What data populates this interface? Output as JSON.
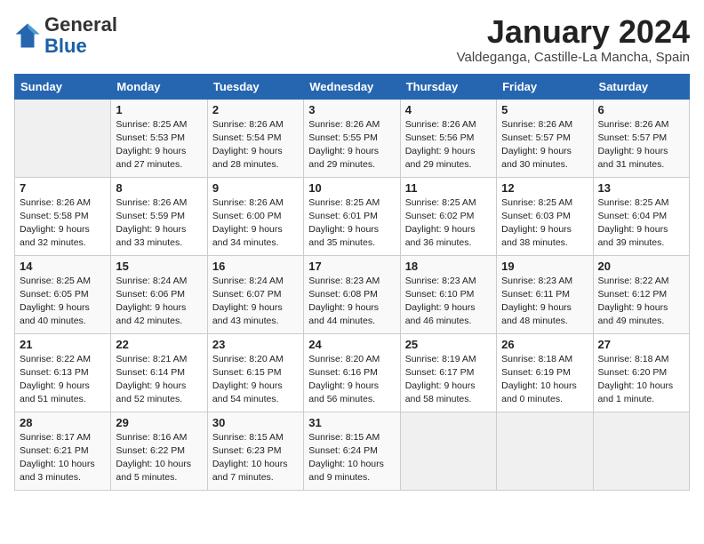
{
  "header": {
    "logo_general": "General",
    "logo_blue": "Blue",
    "title": "January 2024",
    "subtitle": "Valdeganga, Castille-La Mancha, Spain"
  },
  "days_of_week": [
    "Sunday",
    "Monday",
    "Tuesday",
    "Wednesday",
    "Thursday",
    "Friday",
    "Saturday"
  ],
  "weeks": [
    [
      {
        "day": "",
        "info": ""
      },
      {
        "day": "1",
        "info": "Sunrise: 8:25 AM\nSunset: 5:53 PM\nDaylight: 9 hours\nand 27 minutes."
      },
      {
        "day": "2",
        "info": "Sunrise: 8:26 AM\nSunset: 5:54 PM\nDaylight: 9 hours\nand 28 minutes."
      },
      {
        "day": "3",
        "info": "Sunrise: 8:26 AM\nSunset: 5:55 PM\nDaylight: 9 hours\nand 29 minutes."
      },
      {
        "day": "4",
        "info": "Sunrise: 8:26 AM\nSunset: 5:56 PM\nDaylight: 9 hours\nand 29 minutes."
      },
      {
        "day": "5",
        "info": "Sunrise: 8:26 AM\nSunset: 5:57 PM\nDaylight: 9 hours\nand 30 minutes."
      },
      {
        "day": "6",
        "info": "Sunrise: 8:26 AM\nSunset: 5:57 PM\nDaylight: 9 hours\nand 31 minutes."
      }
    ],
    [
      {
        "day": "7",
        "info": "Sunrise: 8:26 AM\nSunset: 5:58 PM\nDaylight: 9 hours\nand 32 minutes."
      },
      {
        "day": "8",
        "info": "Sunrise: 8:26 AM\nSunset: 5:59 PM\nDaylight: 9 hours\nand 33 minutes."
      },
      {
        "day": "9",
        "info": "Sunrise: 8:26 AM\nSunset: 6:00 PM\nDaylight: 9 hours\nand 34 minutes."
      },
      {
        "day": "10",
        "info": "Sunrise: 8:25 AM\nSunset: 6:01 PM\nDaylight: 9 hours\nand 35 minutes."
      },
      {
        "day": "11",
        "info": "Sunrise: 8:25 AM\nSunset: 6:02 PM\nDaylight: 9 hours\nand 36 minutes."
      },
      {
        "day": "12",
        "info": "Sunrise: 8:25 AM\nSunset: 6:03 PM\nDaylight: 9 hours\nand 38 minutes."
      },
      {
        "day": "13",
        "info": "Sunrise: 8:25 AM\nSunset: 6:04 PM\nDaylight: 9 hours\nand 39 minutes."
      }
    ],
    [
      {
        "day": "14",
        "info": "Sunrise: 8:25 AM\nSunset: 6:05 PM\nDaylight: 9 hours\nand 40 minutes."
      },
      {
        "day": "15",
        "info": "Sunrise: 8:24 AM\nSunset: 6:06 PM\nDaylight: 9 hours\nand 42 minutes."
      },
      {
        "day": "16",
        "info": "Sunrise: 8:24 AM\nSunset: 6:07 PM\nDaylight: 9 hours\nand 43 minutes."
      },
      {
        "day": "17",
        "info": "Sunrise: 8:23 AM\nSunset: 6:08 PM\nDaylight: 9 hours\nand 44 minutes."
      },
      {
        "day": "18",
        "info": "Sunrise: 8:23 AM\nSunset: 6:10 PM\nDaylight: 9 hours\nand 46 minutes."
      },
      {
        "day": "19",
        "info": "Sunrise: 8:23 AM\nSunset: 6:11 PM\nDaylight: 9 hours\nand 48 minutes."
      },
      {
        "day": "20",
        "info": "Sunrise: 8:22 AM\nSunset: 6:12 PM\nDaylight: 9 hours\nand 49 minutes."
      }
    ],
    [
      {
        "day": "21",
        "info": "Sunrise: 8:22 AM\nSunset: 6:13 PM\nDaylight: 9 hours\nand 51 minutes."
      },
      {
        "day": "22",
        "info": "Sunrise: 8:21 AM\nSunset: 6:14 PM\nDaylight: 9 hours\nand 52 minutes."
      },
      {
        "day": "23",
        "info": "Sunrise: 8:20 AM\nSunset: 6:15 PM\nDaylight: 9 hours\nand 54 minutes."
      },
      {
        "day": "24",
        "info": "Sunrise: 8:20 AM\nSunset: 6:16 PM\nDaylight: 9 hours\nand 56 minutes."
      },
      {
        "day": "25",
        "info": "Sunrise: 8:19 AM\nSunset: 6:17 PM\nDaylight: 9 hours\nand 58 minutes."
      },
      {
        "day": "26",
        "info": "Sunrise: 8:18 AM\nSunset: 6:19 PM\nDaylight: 10 hours\nand 0 minutes."
      },
      {
        "day": "27",
        "info": "Sunrise: 8:18 AM\nSunset: 6:20 PM\nDaylight: 10 hours\nand 1 minute."
      }
    ],
    [
      {
        "day": "28",
        "info": "Sunrise: 8:17 AM\nSunset: 6:21 PM\nDaylight: 10 hours\nand 3 minutes."
      },
      {
        "day": "29",
        "info": "Sunrise: 8:16 AM\nSunset: 6:22 PM\nDaylight: 10 hours\nand 5 minutes."
      },
      {
        "day": "30",
        "info": "Sunrise: 8:15 AM\nSunset: 6:23 PM\nDaylight: 10 hours\nand 7 minutes."
      },
      {
        "day": "31",
        "info": "Sunrise: 8:15 AM\nSunset: 6:24 PM\nDaylight: 10 hours\nand 9 minutes."
      },
      {
        "day": "",
        "info": ""
      },
      {
        "day": "",
        "info": ""
      },
      {
        "day": "",
        "info": ""
      }
    ]
  ]
}
